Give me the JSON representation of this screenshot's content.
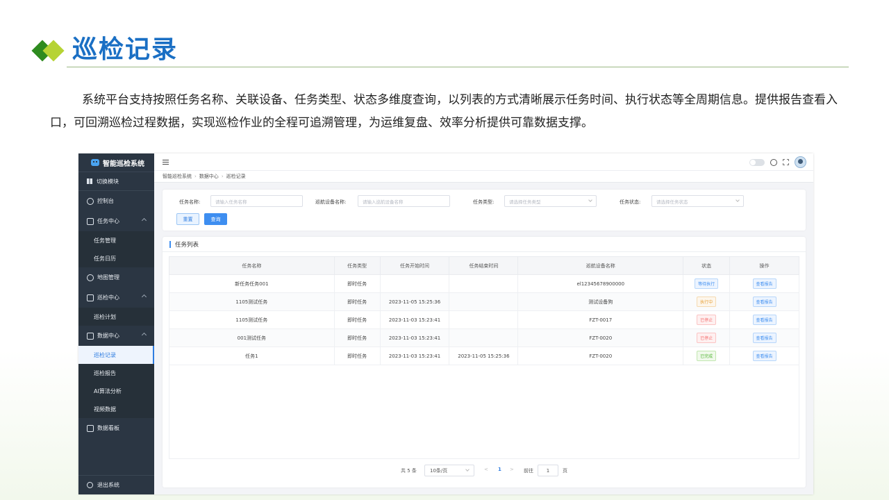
{
  "slide": {
    "title": "巡检记录",
    "description": "系统平台支持按照任务名称、关联设备、任务类型、状态多维度查询，以列表的方式清晰展示任务时间、执行状态等全周期信息。提供报告查看入口，可回溯巡检过程数据，实现巡检作业的全程可追溯管理，为运维复盘、效率分析提供可靠数据支撑。"
  },
  "app": {
    "brand": "智能巡检系统",
    "switch_module": "切换模块",
    "nav": {
      "dashboard": "控制台",
      "task_center": "任务中心",
      "task_manage": "任务管理",
      "task_calendar": "任务日历",
      "map_manage": "地图管理",
      "patrol_center": "巡检中心",
      "patrol_plan": "巡检计划",
      "data_center": "数据中心",
      "patrol_record": "巡检记录",
      "patrol_report": "巡检报告",
      "ai_analysis": "AI算法分析",
      "video_data": "视频数据",
      "data_board": "数据看板",
      "logout": "退出系统"
    },
    "breadcrumb": [
      "智能巡检系统",
      "数据中心",
      "巡检记录"
    ],
    "filters": {
      "task_name_label": "任务名称:",
      "task_name_placeholder": "请输入任务名称",
      "device_label": "巡航设备名称:",
      "device_placeholder": "请输入巡航设备名称",
      "type_label": "任务类型:",
      "type_placeholder": "请选择任务类型",
      "status_label": "任务状态:",
      "status_placeholder": "请选择任务状态",
      "reset": "重置",
      "query": "查询"
    },
    "list_title": "任务列表",
    "table": {
      "headers": [
        "任务名称",
        "任务类型",
        "任务开始时间",
        "任务结束时间",
        "巡航设备名称",
        "状态",
        "操作"
      ],
      "rows": [
        {
          "name": "新任务任务001",
          "type": "即时任务",
          "start": "",
          "end": "",
          "device": "el12345678900000",
          "status": "等待执行",
          "status_kind": "wait",
          "op": "查看报告"
        },
        {
          "name": "1105测试任务",
          "type": "即时任务",
          "start": "2023-11-05 15:25:36",
          "end": "",
          "device": "测试设备狗",
          "status": "执行中",
          "status_kind": "run",
          "op": "查看报告"
        },
        {
          "name": "1105测试任务",
          "type": "即时任务",
          "start": "2023-11-03 15:23:41",
          "end": "",
          "device": "FZT-0017",
          "status": "已停止",
          "status_kind": "stop",
          "op": "查看报告"
        },
        {
          "name": "001测试任务",
          "type": "即时任务",
          "start": "2023-11-03 15:23:41",
          "end": "",
          "device": "FZT-0020",
          "status": "已停止",
          "status_kind": "stop",
          "op": "查看报告"
        },
        {
          "name": "任务1",
          "type": "即时任务",
          "start": "2023-11-03 15:23:41",
          "end": "2023-11-05 15:25:36",
          "device": "FZT-0020",
          "status": "已完成",
          "status_kind": "done",
          "op": "查看报告"
        }
      ]
    },
    "pager": {
      "total": "共 5 条",
      "page_size": "10条/页",
      "prev": "<",
      "current": "1",
      "next": ">",
      "goto": "前往",
      "goto_value": "1",
      "page_unit": "页"
    }
  }
}
